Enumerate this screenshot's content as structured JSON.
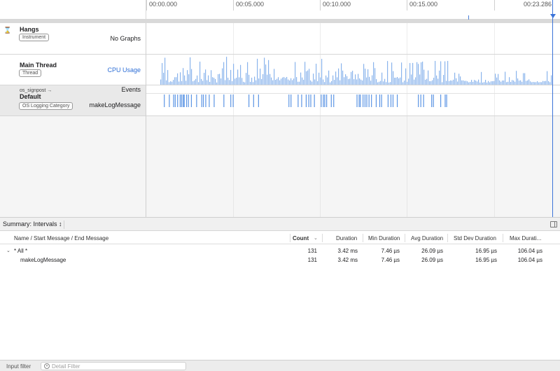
{
  "ruler": {
    "ticks": [
      "00:00.000",
      "00:05.000",
      "00:10.000",
      "00:15.000"
    ],
    "end": "00:23.286"
  },
  "tracks": {
    "hangs": {
      "name": "Hangs",
      "tag": "Instrument",
      "right": "No Graphs"
    },
    "main_thread": {
      "name": "Main Thread",
      "tag": "Thread",
      "right": "CPU Usage"
    },
    "signpost": {
      "subsystem": "os_signpost →",
      "name": "Default",
      "tag": "OS Logging Category",
      "right_top": "Events",
      "right": "makeLogMessage"
    }
  },
  "summary": {
    "label": "Summary: Intervals ↕"
  },
  "table": {
    "headers": {
      "name": "Name / Start Message / End Message",
      "count": "Count",
      "duration": "Duration",
      "min": "Min Duration",
      "avg": "Avg Duration",
      "stddev": "Std Dev Duration",
      "max": "Max Durati..."
    },
    "rows": [
      {
        "name": "* All *",
        "count": "131",
        "duration": "3.42 ms",
        "min": "7.46 µs",
        "avg": "26.09 µs",
        "stddev": "16.95 µs",
        "max": "106.04 µs"
      },
      {
        "name": "makeLogMessage",
        "count": "131",
        "duration": "3.42 ms",
        "min": "7.46 µs",
        "avg": "26.09 µs",
        "stddev": "16.95 µs",
        "max": "106.04 µs"
      }
    ]
  },
  "footer": {
    "label": "Input filter",
    "placeholder": "Detail Filter"
  },
  "colors": {
    "accent": "#2f6fd6",
    "graph": "#8ab4ec"
  }
}
